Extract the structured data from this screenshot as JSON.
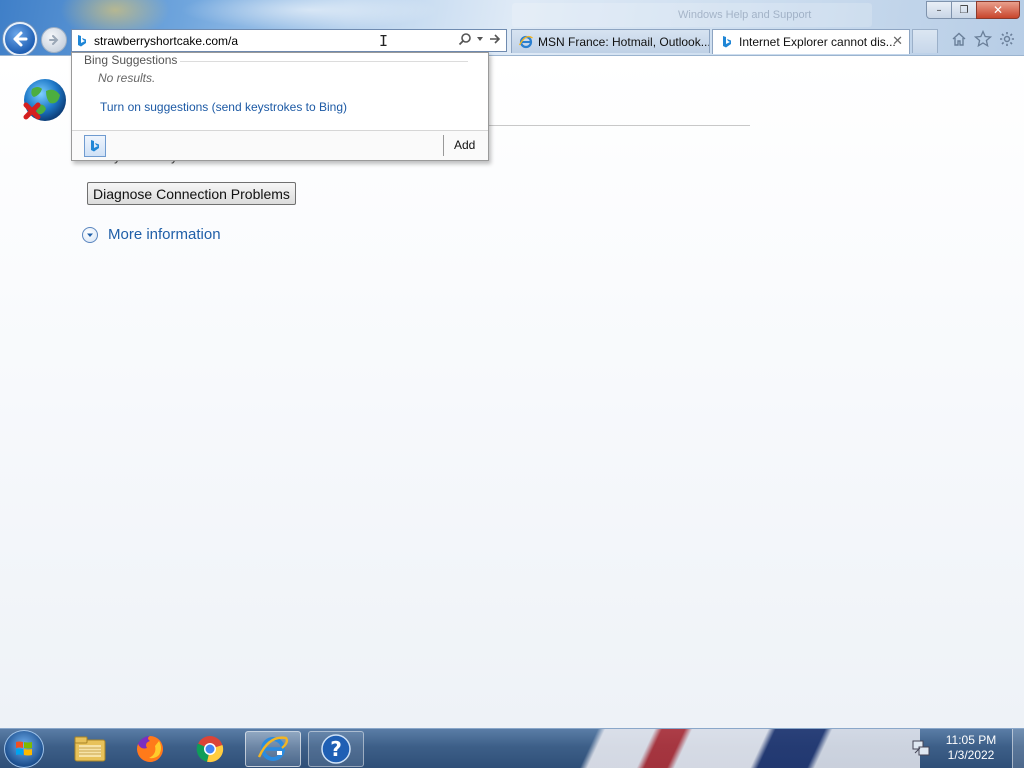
{
  "window": {
    "background_title": "Windows Help and Support",
    "controls": {
      "minimize": "–",
      "maximize": "❐",
      "close": "✕"
    }
  },
  "navigation": {
    "back_icon": "back-arrow-icon",
    "forward_icon": "forward-arrow-icon"
  },
  "address_bar": {
    "value": "strawberryshortcake.com/a",
    "cursor_icon": "text-cursor-icon",
    "search_icon": "search-icon",
    "dropdown_icon": "chevron-down-icon",
    "go_icon": "go-arrow-icon"
  },
  "tabs": [
    {
      "label": "MSN France: Hotmail, Outlook...",
      "icon": "ie-icon",
      "active": false
    },
    {
      "label": "Internet Explorer cannot dis...",
      "icon": "bing-icon",
      "active": true,
      "close": "✕"
    }
  ],
  "toolbar": {
    "icons": [
      "home-icon",
      "favorites-star-icon",
      "settings-gear-icon"
    ]
  },
  "suggestions": {
    "header": "Bing Suggestions",
    "no_results": "No results.",
    "link": "Turn on suggestions (send keystrokes to Bing)",
    "add_label": "Add"
  },
  "page": {
    "partial_text": "What you can try:",
    "diagnose_button": "Diagnose Connection Problems",
    "more_info": "More information"
  },
  "taskbar": {
    "apps": [
      "start-orb",
      "file-explorer",
      "firefox",
      "chrome",
      "internet-explorer",
      "help-and-support"
    ],
    "clock": {
      "time": "11:05 PM",
      "date": "1/3/2022"
    }
  },
  "colors": {
    "link": "#1d5aa5",
    "accent": "#1f5fb4",
    "taskbar": "#3d5f88"
  }
}
